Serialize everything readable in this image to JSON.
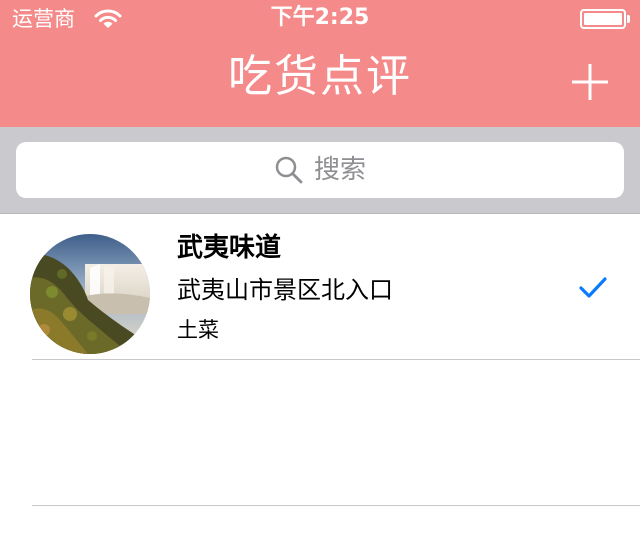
{
  "status_bar": {
    "carrier": "运营商",
    "time": "下午2:25",
    "wifi_icon": "wifi-icon",
    "battery_icon": "battery-icon"
  },
  "nav": {
    "title": "吃货点评",
    "add_icon": "plus-icon"
  },
  "search": {
    "placeholder": "搜索",
    "icon": "search-icon"
  },
  "restaurants": [
    {
      "name": "武夷味道",
      "address": "武夷山市景区北入口",
      "category": "土菜",
      "checked": true,
      "avatar_icon": "waterfall-photo"
    }
  ],
  "colors": {
    "nav_background": "#f48a89",
    "search_bar_background": "#c9c9ce",
    "checkmark": "#0a7aff",
    "separator": "#c8c7cc"
  }
}
